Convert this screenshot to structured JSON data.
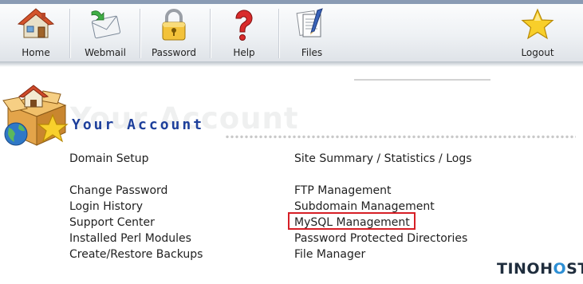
{
  "toolbar": {
    "items": [
      {
        "id": "home",
        "label": "Home",
        "icon": "house-icon"
      },
      {
        "id": "webmail",
        "label": "Webmail",
        "icon": "envelope-icon"
      },
      {
        "id": "password",
        "label": "Password",
        "icon": "padlock-icon"
      },
      {
        "id": "help",
        "label": "Help",
        "icon": "question-mark-icon"
      },
      {
        "id": "files",
        "label": "Files",
        "icon": "files-icon"
      },
      {
        "id": "logout",
        "label": "Logout",
        "icon": "star-icon"
      }
    ]
  },
  "header": {
    "ghost_title": "Your Account",
    "title": "Your Account",
    "logo_icon": "house-box-globe-star-logo"
  },
  "links": {
    "left": [
      "Domain Setup",
      "Change Password",
      "Login History",
      "Support Center",
      "Installed Perl Modules",
      "Create/Restore Backups"
    ],
    "right": [
      "Site Summary / Statistics / Logs",
      "FTP Management",
      "Subdomain Management",
      "MySQL Management",
      "Password Protected Directories",
      "File Manager"
    ]
  },
  "highlight": {
    "target": "MySQL Management",
    "color": "#d61f26"
  },
  "watermark": {
    "prefix": "TINOH",
    "o": "O",
    "suffix": "ST"
  },
  "colors": {
    "title": "#1d3f9b",
    "accent_star": "#f4c21a"
  }
}
